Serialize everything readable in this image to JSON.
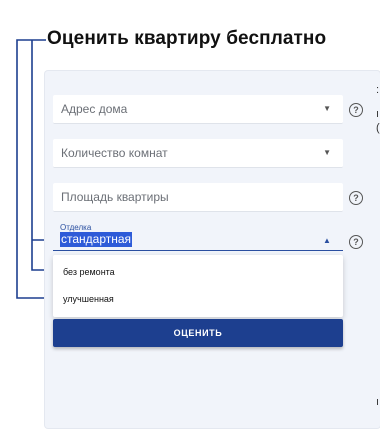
{
  "header": {
    "title": "Оценить квартиру бесплатно"
  },
  "form": {
    "address_placeholder": "Адрес дома",
    "rooms_placeholder": "Количество комнат",
    "area_placeholder": "Площадь квартиры",
    "finish": {
      "label": "Отделка",
      "selected": "стандартная",
      "options": [
        "без ремонта",
        "улучшенная"
      ]
    },
    "submit_label": "ОЦЕНИТЬ",
    "help_icon": "?"
  },
  "annotation_color": "#1d3f8f",
  "accent_color": "#1d3f8f"
}
